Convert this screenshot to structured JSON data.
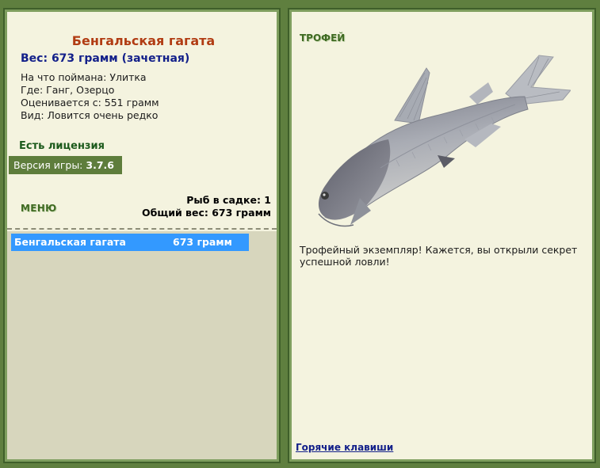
{
  "fish": {
    "name": "Бенгальская гагата",
    "weight_line": "Вес: 673 грамм (зачетная)",
    "bait_line": "На что поймана: Улитка",
    "where_line": "Где: Ганг, Озерцо",
    "rating_line": "Оценивается с: 551 грамм",
    "kind_line": "Вид: Ловится очень редко"
  },
  "license": "Есть лицензия",
  "version": {
    "label": "Версия игры:",
    "number": "3.7.6"
  },
  "menu_label": "МЕНЮ",
  "summary": {
    "fish_count_line": "Рыб в садке: 1",
    "total_weight_line": "Общий вес: 673 грамм"
  },
  "catch_list": [
    {
      "name": "Бенгальская гагата",
      "weight": "673 грамм"
    }
  ],
  "trophy": {
    "label": "ТРОФЕЙ",
    "text": "Трофейный экземпляр! Кажется, вы открыли секрет успешной ловли!"
  },
  "hotkeys_label": "Горячие клавиши"
}
